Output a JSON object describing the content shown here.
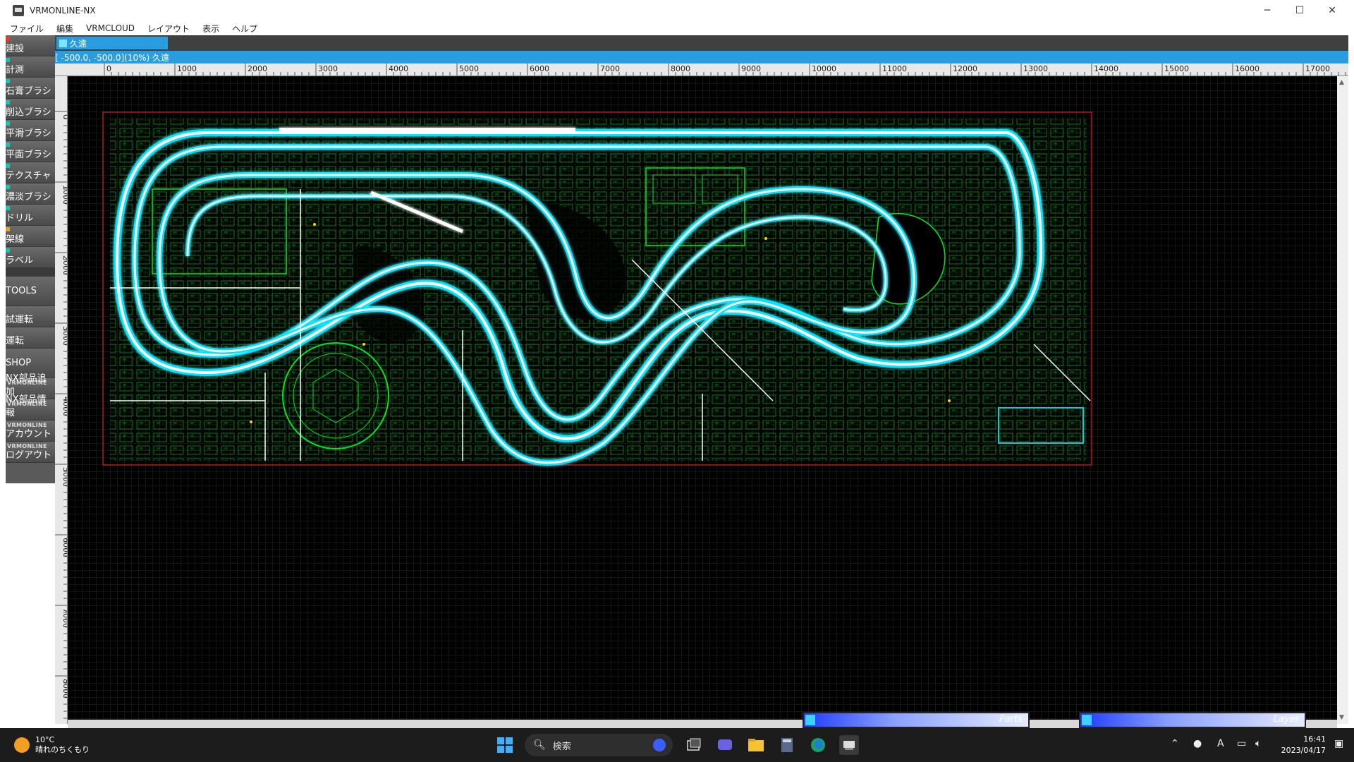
{
  "window": {
    "title": "VRMONLINE-NX"
  },
  "menu": [
    "ファイル",
    "編集",
    "VRMCLOUD",
    "レイアウト",
    "表示",
    "ヘルプ"
  ],
  "tools": [
    {
      "label": "建設"
    },
    {
      "label": "計測"
    },
    {
      "label": "石膏ブラシ"
    },
    {
      "label": "削込ブラシ"
    },
    {
      "label": "平滑ブラシ"
    },
    {
      "label": "平面ブラシ"
    },
    {
      "label": "テクスチャ"
    },
    {
      "label": "濃淡ブラシ"
    },
    {
      "label": "ドリル"
    },
    {
      "label": "架線"
    },
    {
      "label": "ラベル"
    }
  ],
  "tools2": [
    {
      "label": "TOOLS"
    },
    {
      "label": "試運転"
    },
    {
      "label": "運転"
    },
    {
      "label": "SHOP"
    }
  ],
  "vrm_tools": [
    {
      "sub": "VRMONLINE",
      "label": "NX部品追加"
    },
    {
      "sub": "VRMONLINE",
      "label": "NX部品情報"
    },
    {
      "sub": "VRMONLINE",
      "label": "アカウント"
    },
    {
      "sub": "VRMONLINE",
      "label": "ログアウト"
    }
  ],
  "tab": {
    "label": "久遠"
  },
  "coord": {
    "text": "[ -500.0, -500.0](10%) 久遠"
  },
  "ruler_h": [
    "0",
    "1000",
    "2000",
    "3000",
    "4000",
    "5000",
    "6000",
    "7000",
    "8000",
    "9000",
    "10000",
    "11000",
    "12000",
    "13000",
    "14000",
    "15000",
    "16000",
    "17000"
  ],
  "ruler_v": [
    "0",
    "1000",
    "2000",
    "3000",
    "4000",
    "5000",
    "6000",
    "7000",
    "8000"
  ],
  "panels": {
    "parts": "Parts",
    "layer": "Layer"
  },
  "taskbar": {
    "weather_temp": "10°C",
    "weather_desc": "晴れのちくもり",
    "search_placeholder": "検索",
    "time": "16:41",
    "date": "2023/04/17"
  },
  "colors": {
    "accent": "#2a9de0",
    "track": "#ffffff",
    "track_glow": "#00e5ff",
    "structures": "#00ff22",
    "layout_border": "#ff2020"
  }
}
